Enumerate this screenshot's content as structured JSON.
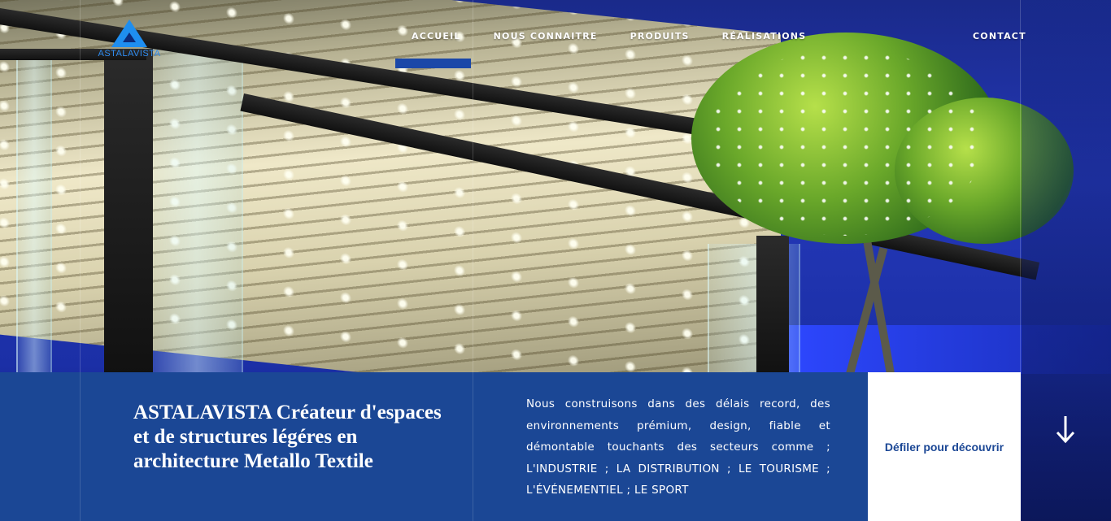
{
  "brand": {
    "logo_text": "ASTALAVISTA"
  },
  "nav": {
    "items": [
      {
        "label": "ACCUEIL"
      },
      {
        "label": "NOUS CONNAITRE"
      },
      {
        "label": "PRODUITS"
      },
      {
        "label": "RÉALISATIONS"
      }
    ],
    "contact": "CONTACT",
    "active_index": 0
  },
  "hero": {
    "headline": "ASTALAVISTA Créateur d'espaces et de structures légéres en architecture Metallo Textile",
    "description": "Nous construisons dans des délais record, des environnements prémium, design, fiable et démontable touchants des secteurs comme ; L'INDUSTRIE ; LA DISTRIBUTION ; LE TOURISME ; L'ÉVÉNEMENTIEL ; LE SPORT",
    "scroll_label": "Défiler pour découvrir",
    "scroll_icon": "arrow-down-icon"
  },
  "colors": {
    "accent": "#1b4795",
    "logo_blue": "#1e8ef0",
    "white": "#ffffff"
  }
}
